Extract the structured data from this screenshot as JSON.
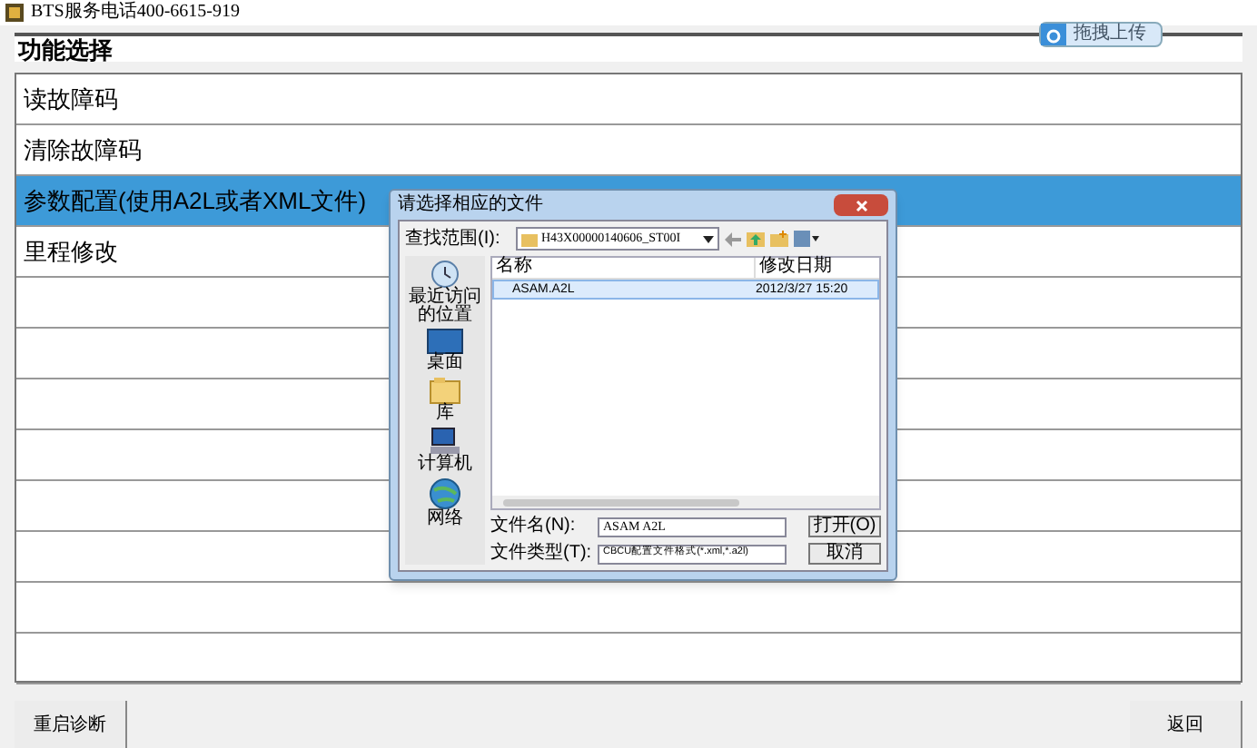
{
  "window": {
    "title": "BTS服务电话400-6615-919"
  },
  "upload_button": "拖拽上传",
  "header": "功能选择",
  "menu": [
    {
      "label": "读故障码",
      "selected": false
    },
    {
      "label": "清除故障码",
      "selected": false
    },
    {
      "label": "参数配置(使用A2L或者XML文件)",
      "selected": true
    },
    {
      "label": "里程修改",
      "selected": false
    }
  ],
  "dialog": {
    "title": "请选择相应的文件",
    "look_in_label": "查找范围(I):",
    "path": "H43X00000140606_ST00I",
    "places": [
      {
        "label": "最近访问的位置",
        "kind": "recent"
      },
      {
        "label": "桌面",
        "kind": "desktop"
      },
      {
        "label": "库",
        "kind": "library"
      },
      {
        "label": "计算机",
        "kind": "computer"
      },
      {
        "label": "网络",
        "kind": "network"
      }
    ],
    "columns": [
      "名称",
      "修改日期"
    ],
    "files": [
      {
        "name": "ASAM.A2L",
        "date": "2012/3/27 15:20",
        "selected": true
      }
    ],
    "filename_label": "文件名(N):",
    "filename": "ASAM A2L",
    "filetype_label": "文件类型(T):",
    "filetype": "CBCU配置文件格式(*.xml,*.a2l)",
    "open_button": "打开(O)",
    "cancel_button": "取消"
  },
  "footer_buttons": [
    "重启诊断",
    "返回"
  ]
}
